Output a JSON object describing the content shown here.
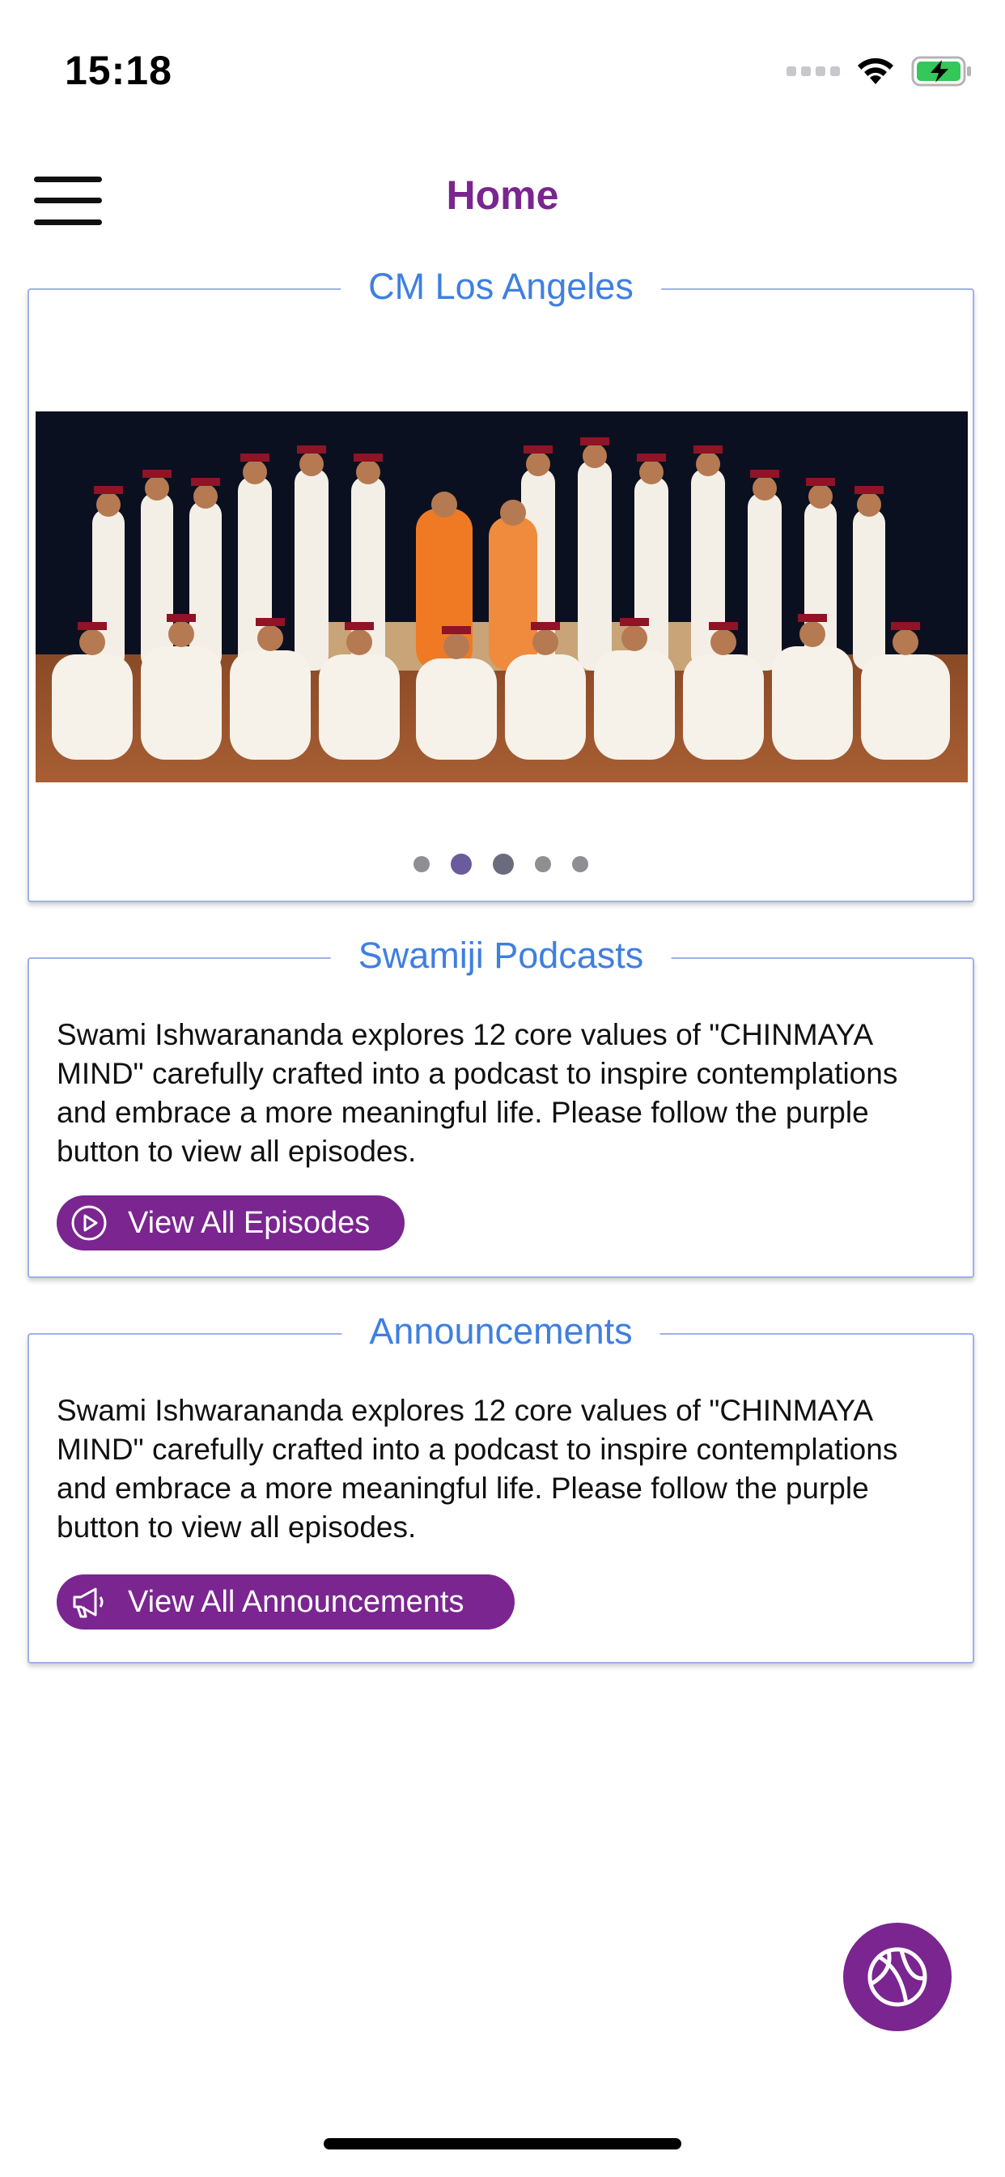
{
  "status_bar": {
    "time": "15:18"
  },
  "header": {
    "title": "Home"
  },
  "carousel": {
    "title": "CM Los Angeles",
    "image_alt": "",
    "dots": 5,
    "active_index": 1
  },
  "podcasts": {
    "title": "Swamiji Podcasts",
    "description": "Swami Ishwarananda explores 12 core values of \"CHINMAYA MIND\" carefully crafted into a podcast to inspire contemplations and embrace a more meaningful life. Please follow the purple button to view all episodes.",
    "button_label": "View All Episodes"
  },
  "announcements": {
    "title": "Announcements",
    "description": "Swami Ishwarananda explores 12 core values of \"CHINMAYA MIND\" carefully crafted into a podcast to inspire contemplations and embrace a more meaningful life. Please follow the purple button to view all episodes.",
    "button_label": "View All Announcements"
  },
  "colors": {
    "brand_purple": "#7a2590",
    "legend_blue": "#3f7fe0",
    "card_border": "#9fb1e8"
  },
  "icons": {
    "menu": "hamburger-menu-icon",
    "play": "play-circle-icon",
    "megaphone": "megaphone-icon",
    "fab": "basketball-icon"
  }
}
